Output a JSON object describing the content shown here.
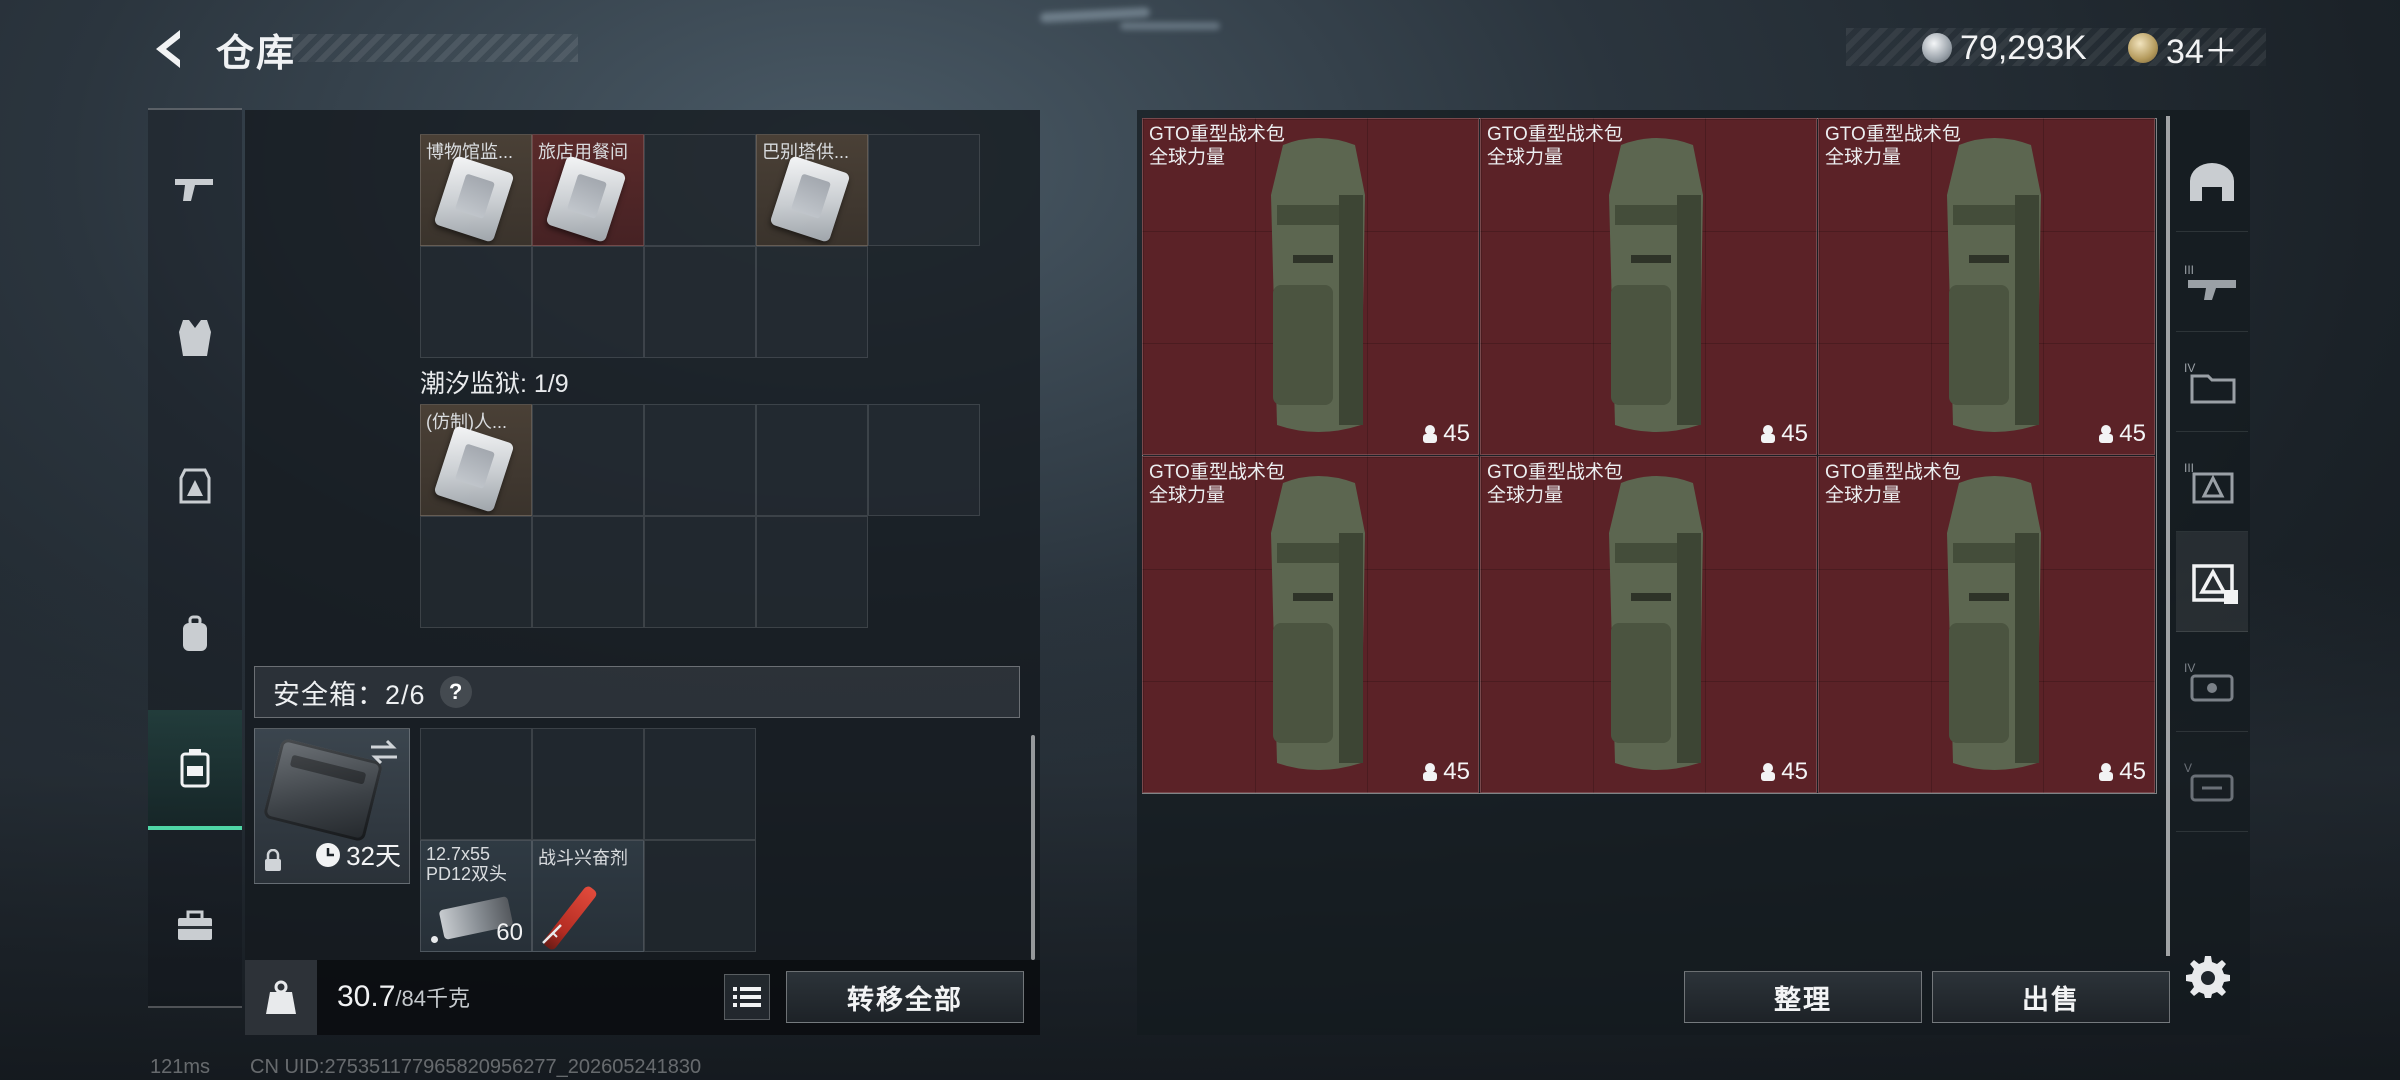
{
  "header": {
    "title": "仓库",
    "currency_silver": "79,293K",
    "currency_gold": "34＋"
  },
  "left_nav": [
    "weapon-icon",
    "armor-vest-icon",
    "chest-rig-icon",
    "backpack-icon",
    "safe-case-icon",
    "toolbox-icon"
  ],
  "backpack": {
    "group1": {
      "label": "",
      "items": [
        "博物馆监...",
        "旅店用餐间",
        "巴别塔供..."
      ]
    },
    "group2": {
      "label": "潮汐监狱: 1/9",
      "items": [
        "(仿制)人..."
      ]
    }
  },
  "safe_box": {
    "label": "安全箱：2/6",
    "help": "?",
    "duration": "32天",
    "items": [
      {
        "name": "12.7x55 PD12双头",
        "count": "60"
      },
      {
        "name": "战斗兴奋剂",
        "count": ""
      }
    ]
  },
  "weight": {
    "current": "30.7",
    "max": "/84千克"
  },
  "buttons": {
    "transfer_all": "转移全部",
    "sort": "整理",
    "sell": "出售"
  },
  "container": {
    "items": [
      {
        "name": "GTO重型战术包",
        "sub": "全球力量",
        "level": "45"
      },
      {
        "name": "GTO重型战术包",
        "sub": "全球力量",
        "level": "45"
      },
      {
        "name": "GTO重型战术包",
        "sub": "全球力量",
        "level": "45"
      },
      {
        "name": "GTO重型战术包",
        "sub": "全球力量",
        "level": "45"
      },
      {
        "name": "GTO重型战术包",
        "sub": "全球力量",
        "level": "45"
      },
      {
        "name": "GTO重型战术包",
        "sub": "全球力量",
        "level": "45"
      }
    ]
  },
  "right_nav": [
    "helmet-icon",
    "rifle-tier3-icon",
    "folder-tier4-icon",
    "chest-tier3-icon",
    "safe-case-active-icon",
    "case-tier4-icon",
    "case-tier5-icon"
  ],
  "status": {
    "ping": "121ms",
    "uid": "CN UID:275351177965820956277_202605241830"
  }
}
